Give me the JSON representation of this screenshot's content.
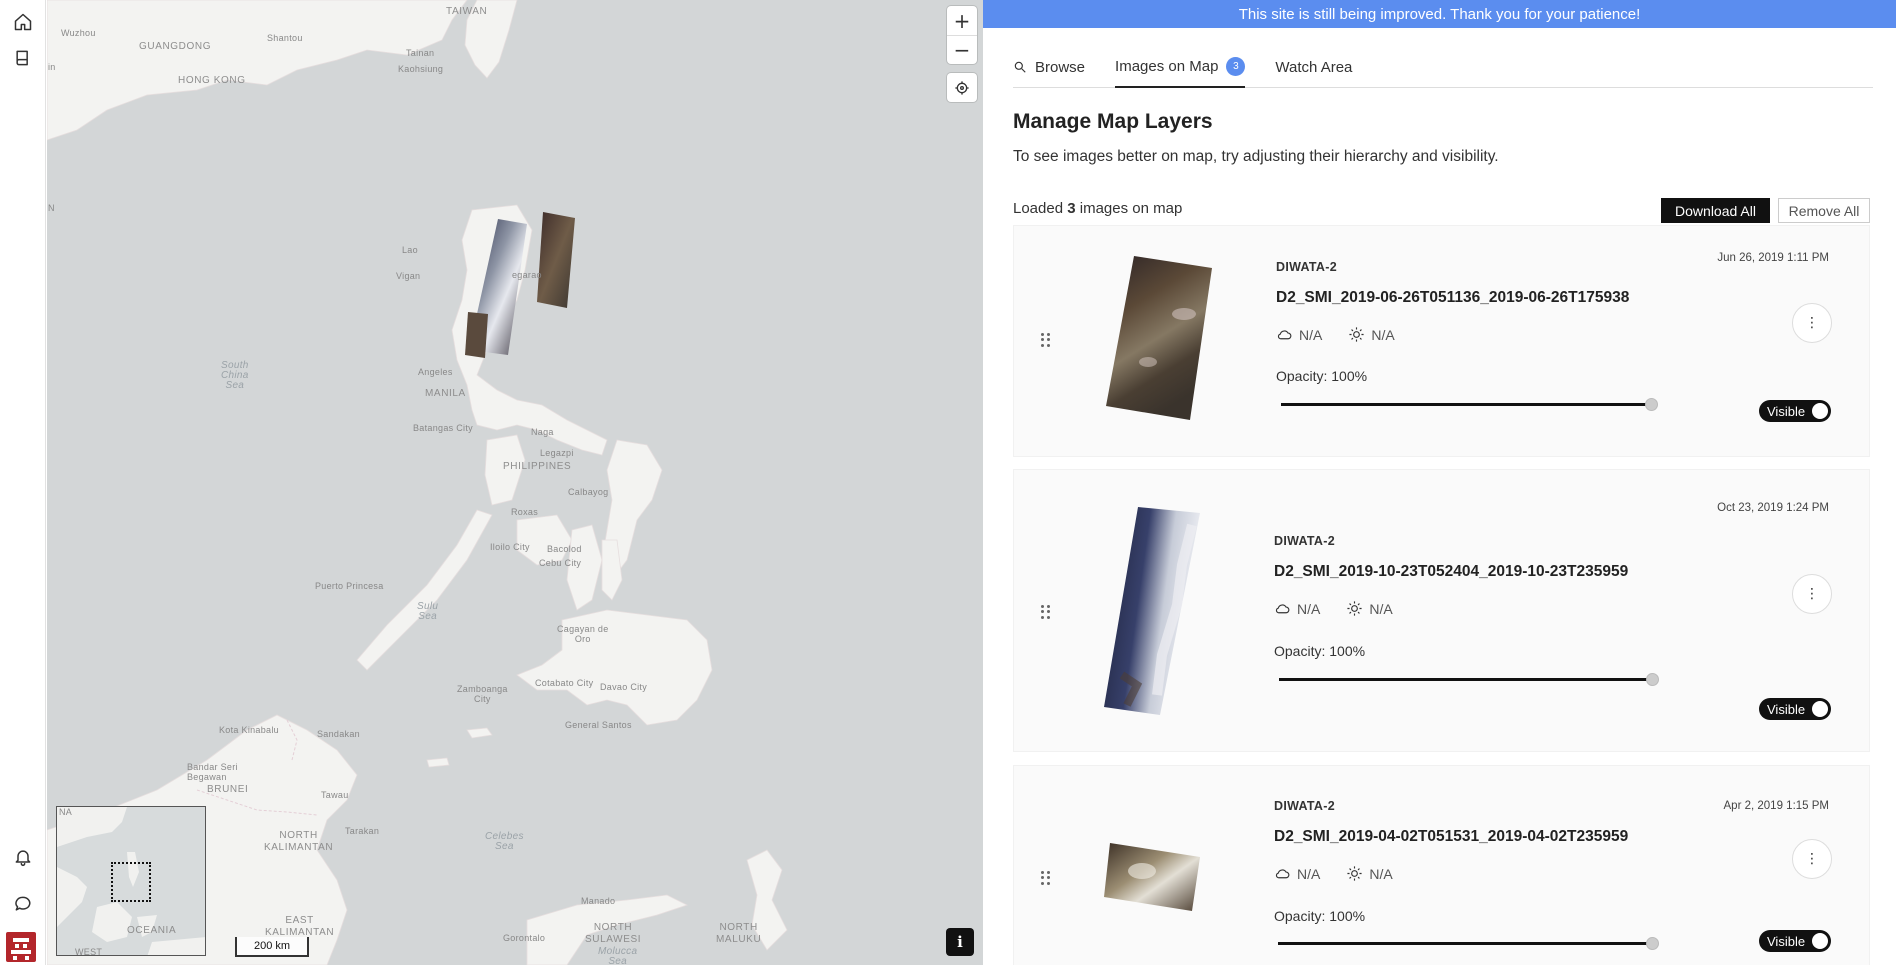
{
  "banner": "This site is still being improved. Thank you for your patience!",
  "rail": {
    "top_icons": [
      "home-icon",
      "book-icon"
    ],
    "bottom_icons": [
      "bell-icon",
      "chat-icon"
    ]
  },
  "map": {
    "labels": {
      "taiwan": "TAIWAN",
      "guangdong": "GUANGDONG",
      "hongkong": "HONG KONG",
      "shantou": "Shantou",
      "wuzhou": "Wuzhou",
      "tainan": "Tainan",
      "kaohsiung": "Kaohsiung",
      "south_china_sea": "South\nChina\nSea",
      "angeles": "Angeles",
      "manila": "MANILA",
      "batangas": "Batangas City",
      "naga": "Naga",
      "philippines": "PHILIPPINES",
      "legazpi": "Legazpi",
      "calbayog": "Calbayog",
      "roxas": "Roxas",
      "iloilo": "Iloilo City",
      "bacolod": "Bacolod",
      "cebu": "Cebu City",
      "puerto_princesa": "Puerto Princesa",
      "sulu_sea": "Sulu\nSea",
      "cagayan": "Cagayan de\nOro",
      "zamboanga": "Zamboanga\nCity",
      "cotabato": "Cotabato City",
      "davao": "Davao City",
      "general_santos": "General Santos",
      "kota_kinabalu": "Kota Kinabalu",
      "sandakan": "Sandakan",
      "bandar": "Bandar Seri\nBegawan",
      "brunei": "BRUNEI",
      "tawau": "Tawau",
      "north_kalimantan": "NORTH\nKALIMANTAN",
      "tarakan": "Tarakan",
      "celebes_sea": "Celebes\nSea",
      "east_kalimantan": "EAST\nKALIMANTAN",
      "manado": "Manado",
      "north_sulawesi": "NORTH\nSULAWESI",
      "north_maluku": "NORTH\nMALUKU",
      "gorontalo": "Gorontalo",
      "molucca_sea": "Molucca\nSea",
      "oceania": "OCEANIA",
      "west": "WEST",
      "vigan": "Vigan",
      "laoag": "Lao",
      "tuguegarao": "egarao",
      "n_edge": "N",
      "in_edge": "in",
      "na_mini": "NA"
    },
    "controls": {
      "zoom_in": "+",
      "zoom_out": "−"
    },
    "scale": "200 km",
    "info": "i"
  },
  "tabs": [
    {
      "label": "Browse",
      "icon": "search-icon"
    },
    {
      "label": "Images on Map",
      "badge": "3"
    },
    {
      "label": "Watch Area"
    }
  ],
  "heading": "Manage Map Layers",
  "subheading": "To see images better on map, try adjusting their hierarchy and visibility.",
  "loaded": {
    "prefix": "Loaded ",
    "count": "3",
    "suffix": " images on map"
  },
  "actions": {
    "download_all": "Download All",
    "remove_all": "Remove All"
  },
  "images": [
    {
      "satellite": "DIWATA-2",
      "name": "D2_SMI_2019-06-26T051136_2019-06-26T175938",
      "date": "Jun 26, 2019 1:11 PM",
      "cloud": "N/A",
      "sun": "N/A",
      "opacity_label": "Opacity: 100%",
      "opacity": 100,
      "toggle": "Visible"
    },
    {
      "satellite": "DIWATA-2",
      "name": "D2_SMI_2019-10-23T052404_2019-10-23T235959",
      "date": "Oct 23, 2019 1:24 PM",
      "cloud": "N/A",
      "sun": "N/A",
      "opacity_label": "Opacity: 100%",
      "opacity": 100,
      "toggle": "Visible"
    },
    {
      "satellite": "DIWATA-2",
      "name": "D2_SMI_2019-04-02T051531_2019-04-02T235959",
      "date": "Apr 2, 2019 1:15 PM",
      "cloud": "N/A",
      "sun": "N/A",
      "opacity_label": "Opacity: 100%",
      "opacity": 100,
      "toggle": "Visible"
    }
  ],
  "colors": {
    "accent": "#5b8def",
    "dark": "#111111"
  }
}
